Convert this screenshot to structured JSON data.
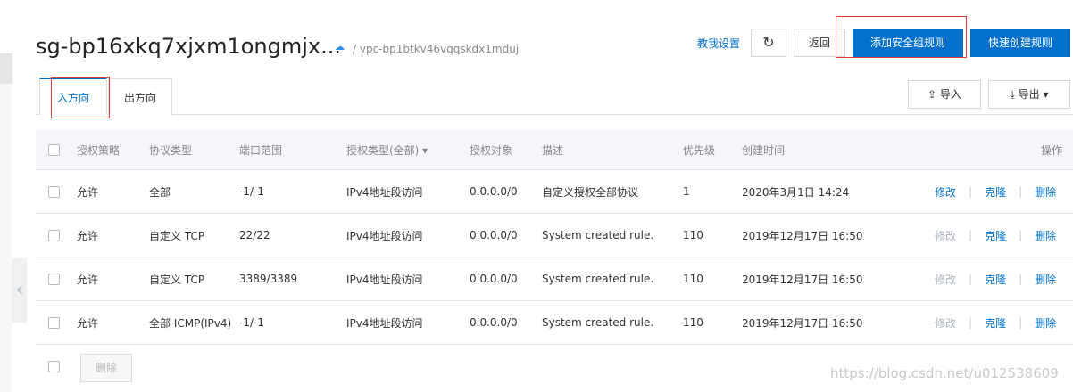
{
  "header": {
    "title": "sg-bp16xkq7xjxm1ongmjx...",
    "vpc": "/ vpc-bp1btkv46vqqskdx1mduj",
    "cloud_icon": "cloud-icon",
    "settings_link": "教我设置",
    "refresh_icon": "↻",
    "back_label": "返回",
    "add_rule_label": "添加安全组规则",
    "quick_create_label": "快速创建规则"
  },
  "tabs": [
    {
      "label": "入方向",
      "active": true
    },
    {
      "label": "出方向",
      "active": false
    }
  ],
  "toolbar": {
    "import_label": "⇪ 导入",
    "export_label": "⤓ 导出 ▾"
  },
  "table": {
    "columns": [
      "授权策略",
      "协议类型",
      "端口范围",
      "授权类型(全部) ▾",
      "授权对象",
      "描述",
      "优先级",
      "创建时间",
      "操作"
    ],
    "rows": [
      {
        "policy": "允许",
        "protocol": "全部",
        "port": "-1/-1",
        "auth_type": "IPv4地址段访问",
        "object": "0.0.0.0/0",
        "desc": "自定义授权全部协议",
        "priority": "1",
        "created": "2020年3月1日 14:24",
        "edit": "修改",
        "clone": "克隆",
        "delete": "删除",
        "edit_disabled": false
      },
      {
        "policy": "允许",
        "protocol": "自定义 TCP",
        "port": "22/22",
        "auth_type": "IPv4地址段访问",
        "object": "0.0.0.0/0",
        "desc": "System created rule.",
        "priority": "110",
        "created": "2019年12月17日 16:50",
        "edit": "修改",
        "clone": "克隆",
        "delete": "删除",
        "edit_disabled": true
      },
      {
        "policy": "允许",
        "protocol": "自定义 TCP",
        "port": "3389/3389",
        "auth_type": "IPv4地址段访问",
        "object": "0.0.0.0/0",
        "desc": "System created rule.",
        "priority": "110",
        "created": "2019年12月17日 16:50",
        "edit": "修改",
        "clone": "克隆",
        "delete": "删除",
        "edit_disabled": true
      },
      {
        "policy": "允许",
        "protocol": "全部 ICMP(IPv4)",
        "port": "-1/-1",
        "auth_type": "IPv4地址段访问",
        "object": "0.0.0.0/0",
        "desc": "System created rule.",
        "priority": "110",
        "created": "2019年12月17日 16:50",
        "edit": "修改",
        "clone": "克隆",
        "delete": "删除",
        "edit_disabled": true
      }
    ]
  },
  "footer": {
    "delete_label": "删除"
  },
  "watermark": "https://blog.csdn.net/u012538609",
  "colors": {
    "primary": "#0070cc",
    "highlight_box": "#e23b3b"
  }
}
